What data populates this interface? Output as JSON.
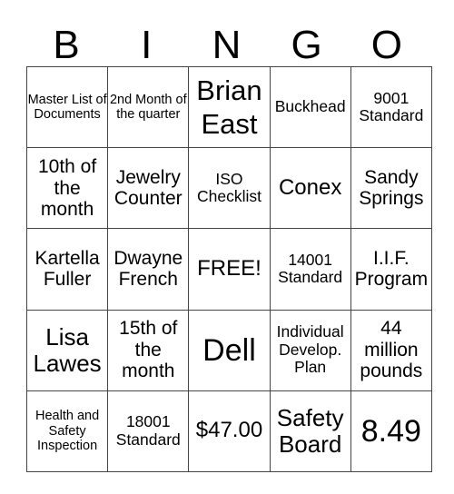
{
  "header": {
    "letters": [
      "B",
      "I",
      "N",
      "G",
      "O"
    ]
  },
  "grid": {
    "rows": [
      [
        "Master List of Documents",
        "2nd Month of the quarter",
        "Brian East",
        "Buckhead",
        "9001 Standard"
      ],
      [
        "10th of the month",
        "Jewelry Counter",
        "ISO Checklist",
        "Conex",
        "Sandy Springs"
      ],
      [
        "Kartella Fuller",
        "Dwayne French",
        "FREE!",
        "14001 Standard",
        "I.I.F. Program"
      ],
      [
        "Lisa Lawes",
        "15th of the month",
        "Dell",
        "Individual Develop. Plan",
        "44 million pounds"
      ],
      [
        "Health and Safety Inspection",
        "18001 Standard",
        "$47.00",
        "Safety Board",
        "8.49"
      ]
    ]
  }
}
